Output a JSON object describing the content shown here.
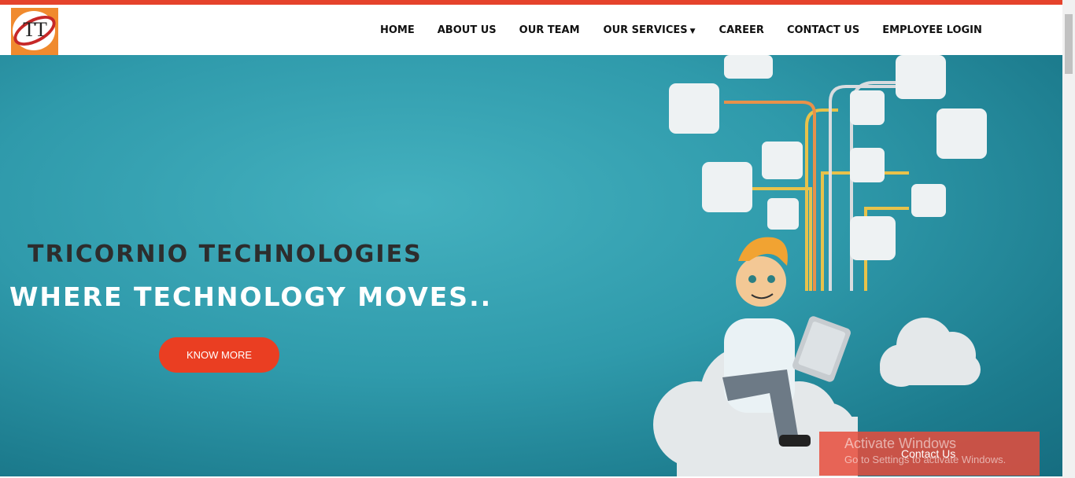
{
  "brand": {
    "logo_text": "TT",
    "accent": "#e5432c"
  },
  "nav": {
    "items": [
      "HOME",
      "ABOUT US",
      "OUR TEAM",
      "OUR SERVICES",
      "CAREER",
      "CONTACT US",
      "EMPLOYEE LOGIN"
    ],
    "dropdown_item": "OUR SERVICES"
  },
  "hero": {
    "title": "TRICORNIO TECHNOLOGIES",
    "subtitle": "WHERE TECHNOLOGY MOVES..",
    "cta": "KNOW MORE",
    "background": "#2f9aab",
    "cta_color": "#ea3e22"
  },
  "floating": {
    "contact_label": "Contact Us"
  },
  "os_watermark": {
    "title": "Activate Windows",
    "subtitle": "Go to Settings to activate Windows."
  }
}
